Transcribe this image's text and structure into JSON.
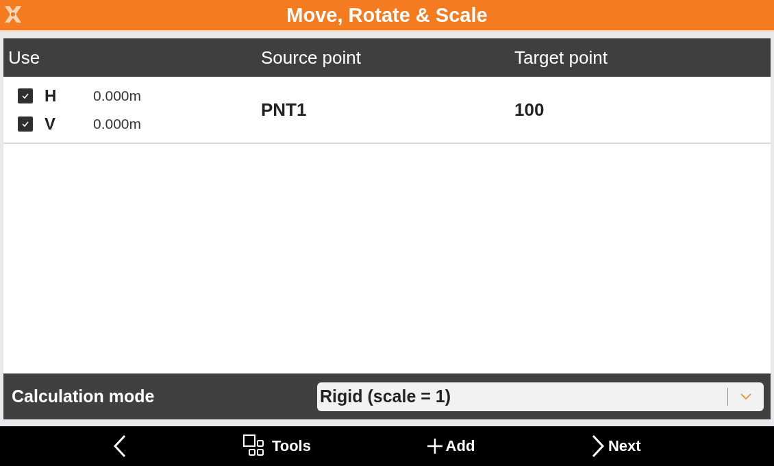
{
  "window": {
    "title": "Move, Rotate & Scale"
  },
  "table": {
    "columns": [
      "Use",
      "Source point",
      "Target point"
    ],
    "rows": [
      {
        "use": [
          {
            "label": "H",
            "checked": true,
            "value": "0.000m"
          },
          {
            "label": "V",
            "checked": true,
            "value": "0.000m"
          }
        ],
        "source": "PNT1",
        "target": "100"
      }
    ]
  },
  "calculation_mode": {
    "label": "Calculation mode",
    "value": "Rigid (scale = 1)"
  },
  "toolbar": [
    {
      "kind": "back"
    },
    {
      "kind": "tools",
      "label": "Tools"
    },
    {
      "kind": "add",
      "label": "Add"
    },
    {
      "kind": "next",
      "label": "Next"
    }
  ]
}
